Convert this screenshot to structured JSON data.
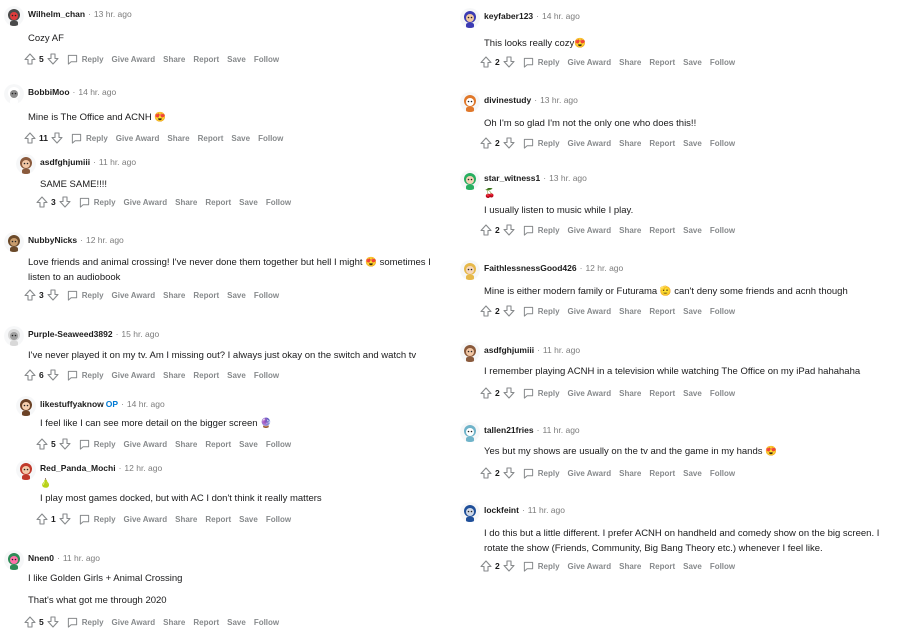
{
  "actions": {
    "reply": "Reply",
    "give_award": "Give Award",
    "share": "Share",
    "report": "Report",
    "save": "Save",
    "follow": "Follow"
  },
  "meta_separator": "·",
  "left_comments": [
    {
      "user": "Wilhelm_chan",
      "time": "13 hr. ago",
      "lines": [
        "Cozy AF"
      ],
      "votes": "5",
      "avatar": "robot-avatar"
    },
    {
      "user": "BobbiMoo",
      "time": "14 hr. ago",
      "lines": [
        "Mine is The Office and ACNH 😍"
      ],
      "votes": "11",
      "avatar": "snoo-avatar"
    },
    {
      "user": "asdfghjumiii",
      "time": "11 hr. ago",
      "lines": [
        "SAME SAME!!!!"
      ],
      "votes": "3",
      "avatar": "girl-avatar"
    },
    {
      "user": "NubbyNicks",
      "time": "12 hr. ago",
      "lines": [
        "Love friends and animal crossing! I've never done them together but hell I might 😍 sometimes I",
        "listen to an audiobook"
      ],
      "votes": "3",
      "avatar": "bear-avatar"
    },
    {
      "user": "Purple-Seaweed3892",
      "time": "15 hr. ago",
      "lines": [
        "I've never played it on my tv. Am I missing out? I always just okay on the switch and watch tv"
      ],
      "votes": "6",
      "avatar": "grey-avatar"
    },
    {
      "user": "likestuffyaknow",
      "op": "OP",
      "time": "14 hr. ago",
      "lines": [
        "I feel like I can see more detail on the bigger screen 🔮"
      ],
      "votes": "5",
      "avatar": "pigtail-avatar"
    },
    {
      "user": "Red_Panda_Mochi",
      "time": "12 hr. ago",
      "flair": "🍐",
      "lines": [
        "I play most games docked, but with AC I don't think it really matters"
      ],
      "votes": "1",
      "avatar": "redhead-avatar"
    },
    {
      "user": "Nnen0",
      "time": "11 hr. ago",
      "lines": [
        "I like Golden Girls + Animal Crossing",
        "That's what got me through 2020"
      ],
      "votes": "5",
      "avatar": "green-avatar"
    }
  ],
  "right_comments": [
    {
      "user": "keyfaber123",
      "time": "14 hr. ago",
      "lines": [
        "This looks really cozy😍"
      ],
      "votes": "2",
      "avatar": "wizard-avatar"
    },
    {
      "user": "divinestudy",
      "time": "13 hr. ago",
      "lines": [
        "Oh I'm so glad I'm not the only one who does this!!"
      ],
      "votes": "2",
      "avatar": "fox-avatar"
    },
    {
      "user": "star_witness1",
      "time": "13 hr. ago",
      "flair": "🍒",
      "lines": [
        "I usually listen to music while I play."
      ],
      "votes": "2",
      "avatar": "green-hair-avatar"
    },
    {
      "user": "FaithlessnessGood426",
      "time": "12 hr. ago",
      "lines": [
        "Mine is either modern family or Futurama 🫡 can't deny some friends and acnh though"
      ],
      "votes": "2",
      "avatar": "blonde-avatar"
    },
    {
      "user": "asdfghjumiii",
      "time": "11 hr. ago",
      "lines": [
        "I remember playing ACNH in a television while watching The Office on my iPad hahahaha"
      ],
      "votes": "2",
      "avatar": "girl-avatar"
    },
    {
      "user": "tallen21fries",
      "time": "11 hr. ago",
      "lines": [
        "Yes but my shows are usually on the tv and the game in my hands 😍"
      ],
      "votes": "2",
      "avatar": "astronaut-avatar"
    },
    {
      "user": "lockfeint",
      "time": "11 hr. ago",
      "lines": [
        "I do this but a little different. I prefer ACNH on handheld and comedy show on the big screen. I",
        "rotate the show (Friends, Community, Big Bang Theory etc.) whenever I feel like."
      ],
      "votes": "2",
      "avatar": "tv-avatar"
    }
  ]
}
